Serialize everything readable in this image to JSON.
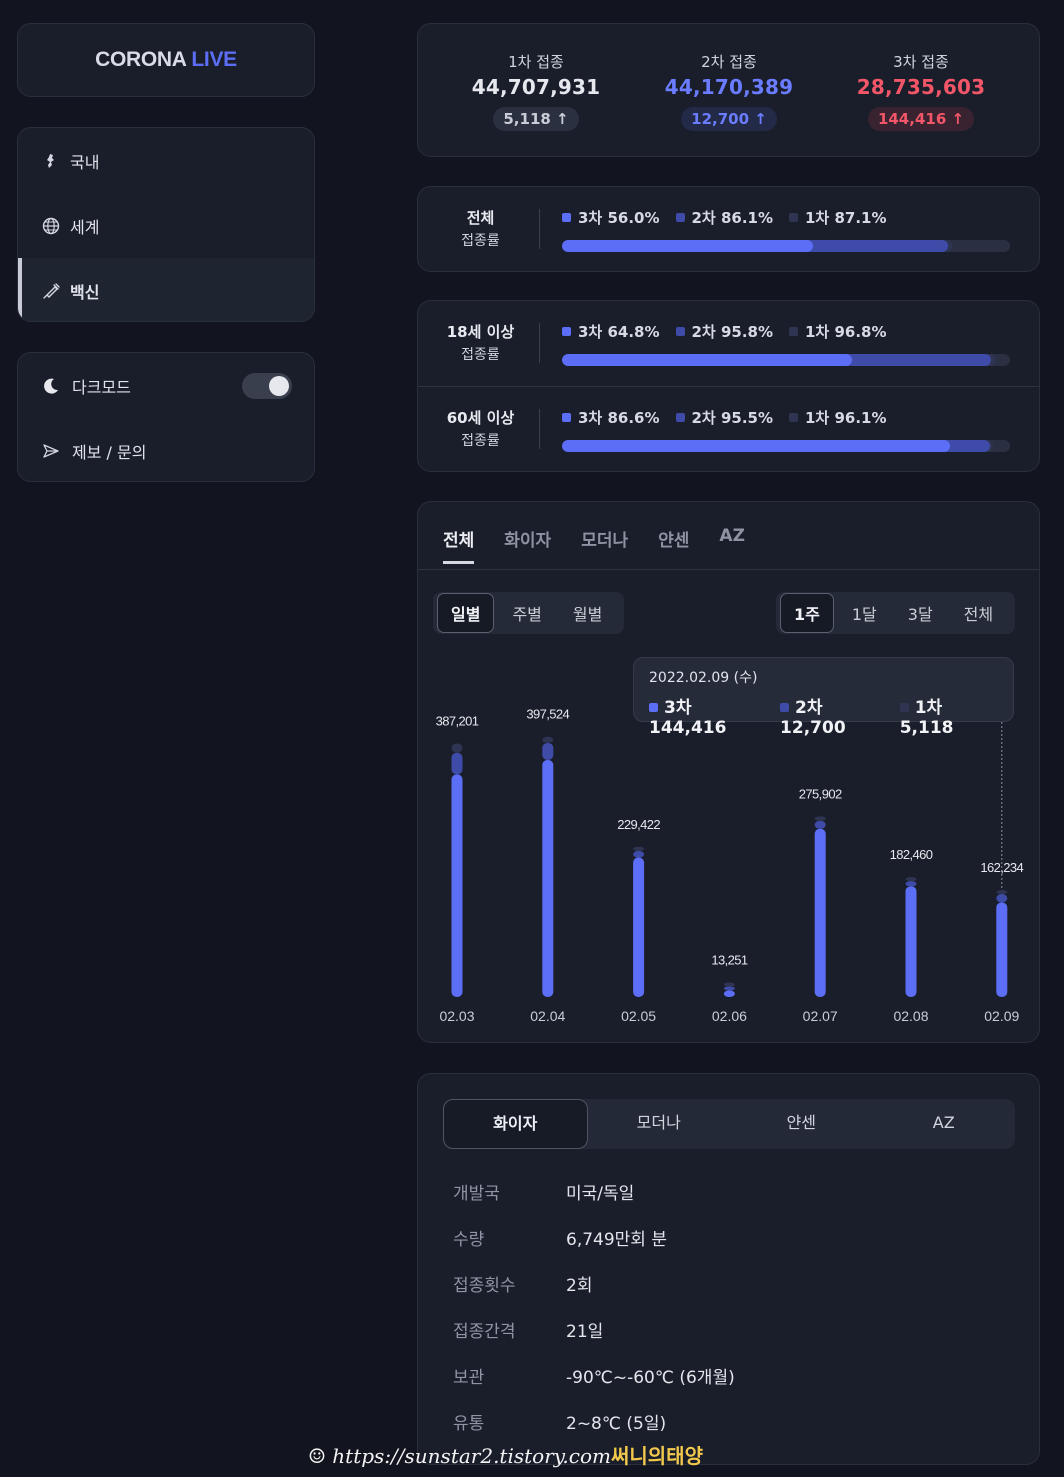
{
  "brand": {
    "part1": "CORONA",
    "part2": "LIVE"
  },
  "nav": [
    {
      "label": "국내",
      "icon": "korea-map-icon"
    },
    {
      "label": "세계",
      "icon": "globe-icon"
    },
    {
      "label": "백신",
      "icon": "syringe-icon"
    }
  ],
  "settings": {
    "darkmode_label": "다크모드",
    "contact_label": "제보 / 문의"
  },
  "stats": [
    {
      "label": "1차 접종",
      "value": "44,707,931",
      "delta": "5,118 ↑",
      "color": "#e6e8ee",
      "pill_bg": "#2b3040",
      "pill_color": "#c9cdd8"
    },
    {
      "label": "2차 접종",
      "value": "44,170,389",
      "delta": "12,700 ↑",
      "color": "#6a7cff",
      "pill_bg": "#232a47",
      "pill_color": "#6a7cff"
    },
    {
      "label": "3차 접종",
      "value": "28,735,603",
      "delta": "144,416 ↑",
      "color": "#f25668",
      "pill_bg": "#3a2330",
      "pill_color": "#f25668"
    }
  ],
  "rates": [
    {
      "title1": "전체",
      "title2": "접종률",
      "third": "3차 56.0%",
      "second": "2차 86.1%",
      "first": "1차 87.1%",
      "p3": 56.0,
      "p2": 86.1,
      "p1": 87.1
    },
    {
      "title1": "18세 이상",
      "title2": "접종률",
      "third": "3차 64.8%",
      "second": "2차 95.8%",
      "first": "1차 96.8%",
      "p3": 64.8,
      "p2": 95.8,
      "p1": 96.8
    },
    {
      "title1": "60세 이상",
      "title2": "접종률",
      "third": "3차 86.6%",
      "second": "2차 95.5%",
      "first": "1차 96.1%",
      "p3": 86.6,
      "p2": 95.5,
      "p1": 96.1
    }
  ],
  "colors": {
    "third": "#5b6ef5",
    "second": "#3e4ba8",
    "first": "#2e3452"
  },
  "chart": {
    "tabs": [
      "전체",
      "화이자",
      "모더나",
      "얀센",
      "AZ"
    ],
    "period_tabs": [
      "일별",
      "주별",
      "월별"
    ],
    "range_tabs": [
      "1주",
      "1달",
      "3달",
      "전체"
    ],
    "tooltip": {
      "date": "2022.02.09 (수)",
      "third": "3차 144,416",
      "second": "2차 12,700",
      "first": "1차 5,118"
    }
  },
  "chart_data": {
    "type": "bar",
    "categories": [
      "02.03",
      "02.04",
      "02.05",
      "02.06",
      "02.07",
      "02.08",
      "02.09"
    ],
    "total_labels": [
      "387,201",
      "397,524",
      "229,422",
      "13,251",
      "275,902",
      "182,460",
      "162,234"
    ],
    "series": [
      {
        "name": "3차",
        "values": [
          340000,
          362000,
          213000,
          10000,
          257000,
          169000,
          144416
        ]
      },
      {
        "name": "2차",
        "values": [
          33000,
          26000,
          10000,
          2000,
          12000,
          8000,
          12700
        ]
      },
      {
        "name": "1차",
        "values": [
          14201,
          9524,
          6422,
          1251,
          6902,
          5460,
          5118
        ]
      }
    ],
    "ylim": [
      0,
      420000
    ]
  },
  "vaccine": {
    "tabs": [
      "화이자",
      "모더나",
      "얀센",
      "AZ"
    ],
    "rows": [
      {
        "k": "개발국",
        "v": "미국/독일"
      },
      {
        "k": "수량",
        "v": "6,749만회 분"
      },
      {
        "k": "접종횟수",
        "v": "2회"
      },
      {
        "k": "접종간격",
        "v": "21일"
      },
      {
        "k": "보관",
        "v": "-90℃~-60℃ (6개월)"
      },
      {
        "k": "유통",
        "v": "2~8℃ (5일)"
      }
    ]
  },
  "watermark": {
    "url": "https://sunstar2.tistory.com",
    "name": "써니의태양"
  }
}
